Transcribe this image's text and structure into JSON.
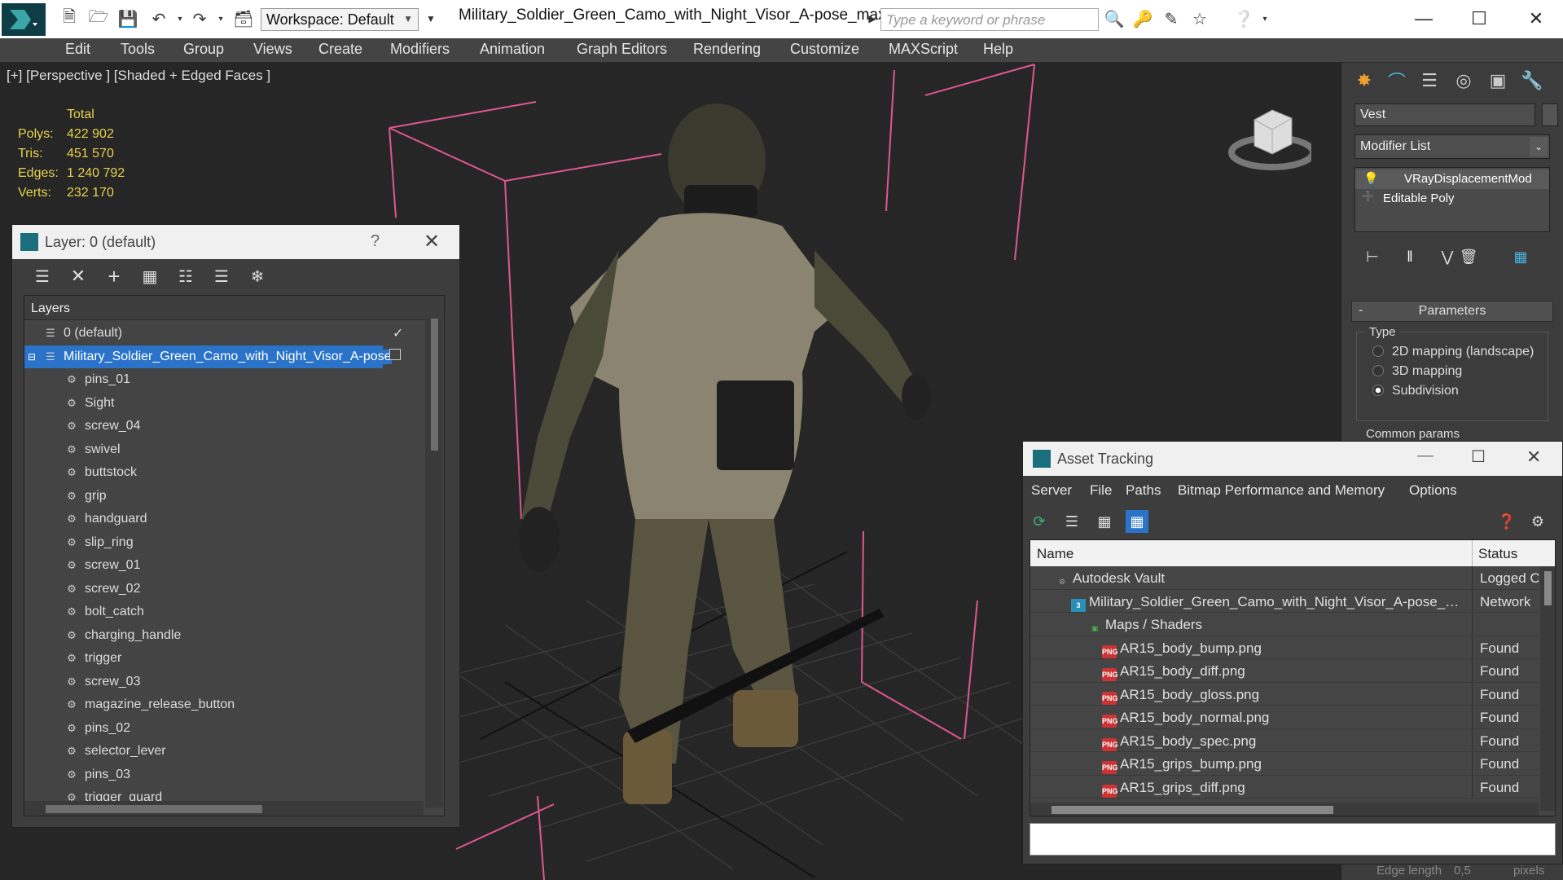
{
  "titlebar": {
    "workspace": "Workspace: Default",
    "file_title": "Military_Soldier_Green_Camo_with_Night_Visor_A-pose_max...",
    "search_placeholder": "Type a keyword or phrase"
  },
  "menubar": [
    "Edit",
    "Tools",
    "Group",
    "Views",
    "Create",
    "Modifiers",
    "Animation",
    "Graph Editors",
    "Rendering",
    "Customize",
    "MAXScript",
    "Help"
  ],
  "viewport": {
    "label": "[+] [Perspective ] [Shaded + Edged Faces ]",
    "stats": {
      "header": "Total",
      "rows": [
        {
          "label": "Polys:",
          "value": "422 902"
        },
        {
          "label": "Tris:",
          "value": "451 570"
        },
        {
          "label": "Edges:",
          "value": "1 240 792"
        },
        {
          "label": "Verts:",
          "value": "232 170"
        }
      ]
    }
  },
  "command_panel": {
    "object_name": "Vest",
    "modifier_list": "Modifier List",
    "stack": [
      "VRayDisplacementMod",
      "Editable Poly"
    ],
    "parameters_title": "Parameters",
    "parameters_minus": "-",
    "type_label": "Type",
    "type_options": [
      {
        "label": "2D mapping (landscape)",
        "selected": false
      },
      {
        "label": "3D mapping",
        "selected": false
      },
      {
        "label": "Subdivision",
        "selected": true
      }
    ],
    "common_params": "Common params",
    "edge_length": "Edge length",
    "edge_value": "0,5",
    "pixels": "pixels"
  },
  "layer_dialog": {
    "title": "Layer: 0 (default)",
    "help": "?",
    "column": "Layers",
    "rows": [
      {
        "label": "0 (default)",
        "level": 1,
        "type": "layer",
        "checked": true
      },
      {
        "label": "Military_Soldier_Green_Camo_with_Night_Visor_A-pose",
        "level": 1,
        "type": "layer",
        "selected": true
      },
      {
        "label": "pins_01",
        "level": 2,
        "type": "object"
      },
      {
        "label": "Sight",
        "level": 2,
        "type": "object"
      },
      {
        "label": "screw_04",
        "level": 2,
        "type": "object"
      },
      {
        "label": "swivel",
        "level": 2,
        "type": "object"
      },
      {
        "label": "buttstock",
        "level": 2,
        "type": "object"
      },
      {
        "label": "grip",
        "level": 2,
        "type": "object"
      },
      {
        "label": "handguard",
        "level": 2,
        "type": "object"
      },
      {
        "label": "slip_ring",
        "level": 2,
        "type": "object"
      },
      {
        "label": "screw_01",
        "level": 2,
        "type": "object"
      },
      {
        "label": "screw_02",
        "level": 2,
        "type": "object"
      },
      {
        "label": "bolt_catch",
        "level": 2,
        "type": "object"
      },
      {
        "label": "charging_handle",
        "level": 2,
        "type": "object"
      },
      {
        "label": "trigger",
        "level": 2,
        "type": "object"
      },
      {
        "label": "screw_03",
        "level": 2,
        "type": "object"
      },
      {
        "label": "magazine_release_button",
        "level": 2,
        "type": "object"
      },
      {
        "label": "pins_02",
        "level": 2,
        "type": "object"
      },
      {
        "label": "selector_lever",
        "level": 2,
        "type": "object"
      },
      {
        "label": "pins_03",
        "level": 2,
        "type": "object"
      },
      {
        "label": "trigger_guard",
        "level": 2,
        "type": "object"
      }
    ]
  },
  "asset_dialog": {
    "title": "Asset Tracking",
    "menu": [
      "Server",
      "File",
      "Paths",
      "Bitmap Performance and Memory",
      "Options"
    ],
    "col_name": "Name",
    "col_status": "Status",
    "rows": [
      {
        "name": "Autodesk Vault",
        "status": "Logged Out",
        "kind": "vault",
        "indent": 1
      },
      {
        "name": "Military_Soldier_Green_Camo_with_Night_Visor_A-pose_max_vray.max",
        "status": "Network",
        "kind": "max",
        "indent": 2
      },
      {
        "name": "Maps / Shaders",
        "status": "",
        "kind": "folder",
        "indent": 3
      },
      {
        "name": "AR15_body_bump.png",
        "status": "Found",
        "kind": "png",
        "indent": 4
      },
      {
        "name": "AR15_body_diff.png",
        "status": "Found",
        "kind": "png",
        "indent": 4
      },
      {
        "name": "AR15_body_gloss.png",
        "status": "Found",
        "kind": "png",
        "indent": 4
      },
      {
        "name": "AR15_body_normal.png",
        "status": "Found",
        "kind": "png",
        "indent": 4
      },
      {
        "name": "AR15_body_spec.png",
        "status": "Found",
        "kind": "png",
        "indent": 4
      },
      {
        "name": "AR15_grips_bump.png",
        "status": "Found",
        "kind": "png",
        "indent": 4
      },
      {
        "name": "AR15_grips_diff.png",
        "status": "Found",
        "kind": "png",
        "indent": 4
      }
    ]
  },
  "colors": {
    "selection": "#2a73c9",
    "stat_text": "#e8d24a",
    "gizmo": "#e0578f"
  }
}
